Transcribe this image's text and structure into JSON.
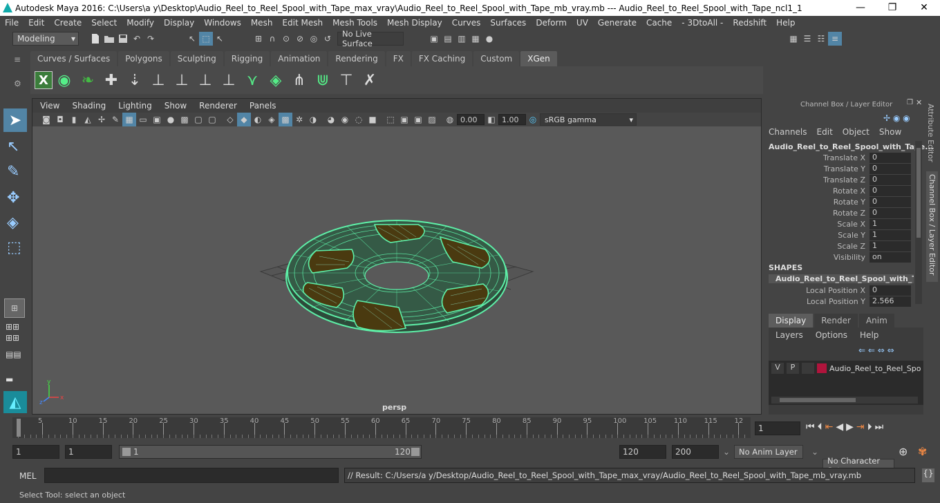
{
  "window": {
    "title": "Autodesk Maya 2016: C:\\Users\\a y\\Desktop\\Audio_Reel_to_Reel_Spool_with_Tape_max_vray\\Audio_Reel_to_Reel_Spool_with_Tape_mb_vray.mb   ---   Audio_Reel_to_Reel_Spool_with_Tape_ncl1_1",
    "minimize": "—",
    "maximize": "❐",
    "close": "✕"
  },
  "menu": [
    "File",
    "Edit",
    "Create",
    "Select",
    "Modify",
    "Display",
    "Windows",
    "Mesh",
    "Edit Mesh",
    "Mesh Tools",
    "Mesh Display",
    "Curves",
    "Surfaces",
    "Deform",
    "UV",
    "Generate",
    "Cache",
    "- 3DtoAll -",
    "Redshift",
    "Help"
  ],
  "statusline": {
    "mode": "Modeling",
    "live_surface": "No Live Surface"
  },
  "shelf": {
    "tabs": [
      "Curves / Surfaces",
      "Polygons",
      "Sculpting",
      "Rigging",
      "Animation",
      "Rendering",
      "FX",
      "FX Caching",
      "Custom",
      "XGen"
    ],
    "active": "XGen"
  },
  "viewport": {
    "menu": [
      "View",
      "Shading",
      "Lighting",
      "Show",
      "Renderer",
      "Panels"
    ],
    "exposure": "0.00",
    "gamma": "1.00",
    "color_space": "sRGB gamma",
    "camera": "persp"
  },
  "channelbox": {
    "title": "Channel Box / Layer Editor",
    "menu": [
      "Channels",
      "Edit",
      "Object",
      "Show"
    ],
    "object": "Audio_Reel_to_Reel_Spool_with_Tape...",
    "attrs": [
      {
        "n": "Translate X",
        "v": "0"
      },
      {
        "n": "Translate Y",
        "v": "0"
      },
      {
        "n": "Translate Z",
        "v": "0"
      },
      {
        "n": "Rotate X",
        "v": "0"
      },
      {
        "n": "Rotate Y",
        "v": "0"
      },
      {
        "n": "Rotate Z",
        "v": "0"
      },
      {
        "n": "Scale X",
        "v": "1"
      },
      {
        "n": "Scale Y",
        "v": "1"
      },
      {
        "n": "Scale Z",
        "v": "1"
      },
      {
        "n": "Visibility",
        "v": "on"
      }
    ],
    "shapes_label": "SHAPES",
    "shape_name": "Audio_Reel_to_Reel_Spool_with_Tap...",
    "shape_attrs": [
      {
        "n": "Local Position X",
        "v": "0"
      },
      {
        "n": "Local Position Y",
        "v": "2.566"
      }
    ]
  },
  "layers": {
    "tabs": [
      "Display",
      "Render",
      "Anim"
    ],
    "menu": [
      "Layers",
      "Options",
      "Help"
    ],
    "layer": {
      "v": "V",
      "p": "P",
      "name": "Audio_Reel_to_Reel_Spo",
      "color": "#b0143c"
    }
  },
  "side_tabs": [
    "Attribute Editor",
    "Channel Box / Layer Editor"
  ],
  "timeline": {
    "ticks": [
      "1",
      "5",
      "10",
      "15",
      "20",
      "25",
      "30",
      "35",
      "40",
      "45",
      "50",
      "55",
      "60",
      "65",
      "70",
      "75",
      "80",
      "85",
      "90",
      "95",
      "100",
      "105",
      "110",
      "115",
      "12"
    ],
    "current": "1"
  },
  "range": {
    "start": "1",
    "anim_start": "1",
    "slider_start": "1",
    "slider_end": "120",
    "end": "120",
    "anim_end": "200",
    "anim_layer": "No Anim Layer",
    "char_set": "No Character Set"
  },
  "command": {
    "lang": "MEL",
    "result": "// Result: C:/Users/a y/Desktop/Audio_Reel_to_Reel_Spool_with_Tape_max_vray/Audio_Reel_to_Reel_Spool_with_Tape_mb_vray.mb"
  },
  "help_line": "Select Tool: select an object",
  "colors": {
    "wire": "#5ef0a8",
    "accent": "#5285a6"
  }
}
